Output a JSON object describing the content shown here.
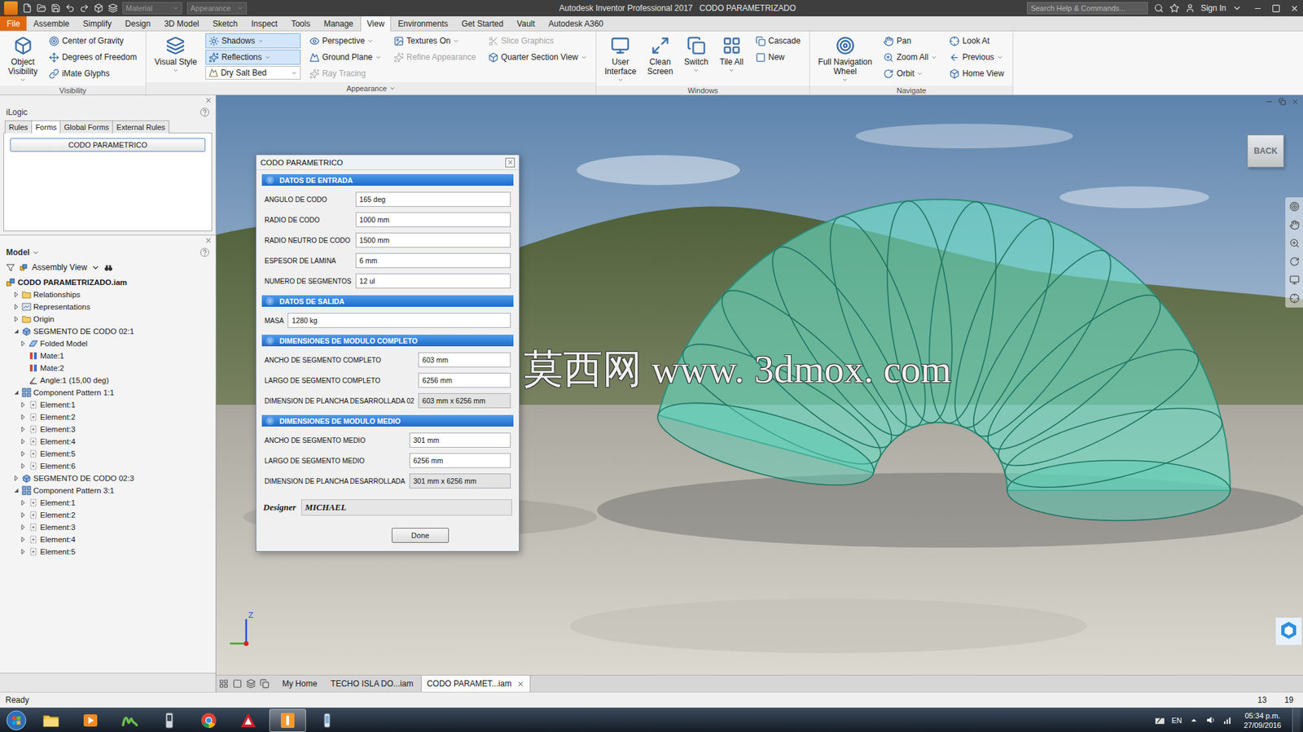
{
  "titlebar": {
    "title": "Autodesk Inventor Professional 2017",
    "document": "CODO PARAMETRIZADO",
    "combos": [
      {
        "label": "Material",
        "disabled": true
      },
      {
        "label": "Appearance",
        "disabled": true
      }
    ],
    "search": {
      "placeholder": "Search Help & Commands..."
    },
    "sign_in": "Sign In"
  },
  "menu_tabs": [
    {
      "label": "File",
      "selected": false,
      "kind": "file"
    },
    {
      "label": "Assemble",
      "selected": false,
      "kind": "tab"
    },
    {
      "label": "Simplify",
      "selected": false,
      "kind": "tab"
    },
    {
      "label": "Design",
      "selected": false,
      "kind": "tab"
    },
    {
      "label": "3D Model",
      "selected": false,
      "kind": "tab"
    },
    {
      "label": "Sketch",
      "selected": false,
      "kind": "tab"
    },
    {
      "label": "Inspect",
      "selected": false,
      "kind": "tab"
    },
    {
      "label": "Tools",
      "selected": false,
      "kind": "tab"
    },
    {
      "label": "Manage",
      "selected": false,
      "kind": "tab"
    },
    {
      "label": "View",
      "selected": true,
      "kind": "tab"
    },
    {
      "label": "Environments",
      "selected": false,
      "kind": "tab"
    },
    {
      "label": "Get Started",
      "selected": false,
      "kind": "tab"
    },
    {
      "label": "Vault",
      "selected": false,
      "kind": "tab"
    },
    {
      "label": "Autodesk A360",
      "selected": false,
      "kind": "tab"
    }
  ],
  "ribbon": {
    "panels": [
      {
        "title": "Visibility",
        "dropdown": false,
        "groups": [
          {
            "kind": "large",
            "items": [
              {
                "lines": [
                  "Object",
                  "Visibility"
                ],
                "dropdown": true,
                "selected": false,
                "disabled": false
              }
            ]
          },
          {
            "kind": "column",
            "items": [
              {
                "label": "Center of Gravity",
                "kind": "button",
                "dropdown": false,
                "selected": false,
                "disabled": false
              },
              {
                "label": "Degrees of Freedom",
                "kind": "button",
                "dropdown": false,
                "selected": false,
                "disabled": false
              },
              {
                "label": "iMate Glyphs",
                "kind": "button",
                "dropdown": false,
                "selected": false,
                "disabled": false
              }
            ]
          }
        ]
      },
      {
        "title": "Appearance",
        "dropdown": true,
        "groups": [
          {
            "kind": "large",
            "items": [
              {
                "lines": [
                  "Visual Style"
                ],
                "dropdown": true,
                "selected": false,
                "disabled": false
              }
            ]
          },
          {
            "kind": "column",
            "items": [
              {
                "label": "Shadows",
                "kind": "button",
                "dropdown": true,
                "selected": true,
                "disabled": false
              },
              {
                "label": "Reflections",
                "kind": "button",
                "dropdown": true,
                "selected": true,
                "disabled": false
              },
              {
                "label": "Dry Salt Bed",
                "kind": "combo",
                "dropdown": true,
                "selected": false,
                "disabled": false
              }
            ]
          },
          {
            "kind": "column",
            "items": [
              {
                "label": "Perspective",
                "kind": "button",
                "dropdown": true,
                "selected": false,
                "disabled": false
              },
              {
                "label": "Ground Plane",
                "kind": "button",
                "dropdown": true,
                "selected": false,
                "disabled": false
              },
              {
                "label": "Ray Tracing",
                "kind": "button",
                "dropdown": false,
                "selected": false,
                "disabled": true
              }
            ]
          },
          {
            "kind": "column",
            "items": [
              {
                "label": "Textures On",
                "kind": "button",
                "dropdown": true,
                "selected": false,
                "disabled": false
              },
              {
                "label": "Refine Appearance",
                "kind": "button",
                "dropdown": false,
                "selected": false,
                "disabled": true
              }
            ]
          },
          {
            "kind": "column",
            "items": [
              {
                "label": "Slice Graphics",
                "kind": "button",
                "dropdown": false,
                "selected": false,
                "disabled": true
              },
              {
                "label": "Quarter Section View",
                "kind": "button",
                "dropdown": true,
                "selected": false,
                "disabled": false
              }
            ]
          }
        ]
      },
      {
        "title": "Windows",
        "dropdown": false,
        "groups": [
          {
            "kind": "large",
            "items": [
              {
                "lines": [
                  "User",
                  "Interface"
                ],
                "dropdown": true,
                "selected": false,
                "disabled": false
              },
              {
                "lines": [
                  "Clean",
                  "Screen"
                ],
                "dropdown": false,
                "selected": false,
                "disabled": false
              },
              {
                "lines": [
                  "Switch"
                ],
                "dropdown": true,
                "selected": false,
                "disabled": false
              },
              {
                "lines": [
                  "Tile All"
                ],
                "dropdown": true,
                "selected": false,
                "disabled": false
              }
            ]
          },
          {
            "kind": "column",
            "items": [
              {
                "label": "Cascade",
                "kind": "button",
                "dropdown": false,
                "selected": false,
                "disabled": false
              },
              {
                "label": "New",
                "kind": "button",
                "dropdown": false,
                "selected": false,
                "disabled": false
              }
            ]
          }
        ]
      },
      {
        "title": "Navigate",
        "dropdown": false,
        "groups": [
          {
            "kind": "large",
            "items": [
              {
                "lines": [
                  "Full Navigation",
                  "Wheel"
                ],
                "dropdown": true,
                "selected": false,
                "disabled": false
              }
            ]
          },
          {
            "kind": "column",
            "items": [
              {
                "label": "Pan",
                "kind": "button",
                "dropdown": false,
                "selected": false,
                "disabled": false
              },
              {
                "label": "Zoom All",
                "kind": "button",
                "dropdown": true,
                "selected": false,
                "disabled": false
              },
              {
                "label": "Orbit",
                "kind": "button",
                "dropdown": true,
                "selected": false,
                "disabled": false
              }
            ]
          },
          {
            "kind": "column",
            "items": [
              {
                "label": "Look At",
                "kind": "button",
                "dropdown": false,
                "selected": false,
                "disabled": false
              },
              {
                "label": "Previous",
                "kind": "button",
                "dropdown": true,
                "selected": false,
                "disabled": false
              },
              {
                "label": "Home View",
                "kind": "button",
                "dropdown": false,
                "selected": false,
                "disabled": false
              }
            ]
          }
        ]
      }
    ]
  },
  "ilogic": {
    "title": "iLogic",
    "tabs": [
      {
        "label": "Rules",
        "selected": false
      },
      {
        "label": "Forms",
        "selected": true
      },
      {
        "label": "Global Forms",
        "selected": false
      },
      {
        "label": "External Rules",
        "selected": false
      }
    ],
    "forms": [
      "CODO PARAMETRICO"
    ]
  },
  "model": {
    "title": "Model",
    "view": "Assembly View",
    "tree": [
      {
        "label": "CODO PARAMETRIZADO.iam",
        "level": 0,
        "kind": "assembly",
        "expandable": false,
        "expanded": false
      },
      {
        "label": "Relationships",
        "level": 1,
        "kind": "folder",
        "expandable": true,
        "expanded": false
      },
      {
        "label": "Representations",
        "level": 1,
        "kind": "representations",
        "expandable": true,
        "expanded": false
      },
      {
        "label": "Origin",
        "level": 1,
        "kind": "folder",
        "expandable": true,
        "expanded": false
      },
      {
        "label": "SEGMENTO DE CODO 02:1",
        "level": 1,
        "kind": "part",
        "expandable": true,
        "expanded": true
      },
      {
        "label": "Folded Model",
        "level": 2,
        "kind": "folded",
        "expandable": true,
        "expanded": false
      },
      {
        "label": "Mate:1",
        "level": 2,
        "kind": "constraint",
        "expandable": false,
        "expanded": false
      },
      {
        "label": "Mate:2",
        "level": 2,
        "kind": "constraint",
        "expandable": false,
        "expanded": false
      },
      {
        "label": "Angle:1 (15,00 deg)",
        "level": 2,
        "kind": "angle",
        "expandable": false,
        "expanded": false
      },
      {
        "label": "Component Pattern 1:1",
        "level": 1,
        "kind": "pattern",
        "expandable": true,
        "expanded": true
      },
      {
        "label": "Element:1",
        "level": 2,
        "kind": "element",
        "expandable": true,
        "expanded": false
      },
      {
        "label": "Element:2",
        "level": 2,
        "kind": "element",
        "expandable": true,
        "expanded": false
      },
      {
        "label": "Element:3",
        "level": 2,
        "kind": "element",
        "expandable": true,
        "expanded": false
      },
      {
        "label": "Element:4",
        "level": 2,
        "kind": "element",
        "expandable": true,
        "expanded": false
      },
      {
        "label": "Element:5",
        "level": 2,
        "kind": "element",
        "expandable": true,
        "expanded": false
      },
      {
        "label": "Element:6",
        "level": 2,
        "kind": "element",
        "expandable": true,
        "expanded": false
      },
      {
        "label": "SEGMENTO DE CODO 02:3",
        "level": 1,
        "kind": "part",
        "expandable": true,
        "expanded": false
      },
      {
        "label": "Component Pattern 3:1",
        "level": 1,
        "kind": "pattern",
        "expandable": true,
        "expanded": true
      },
      {
        "label": "Element:1",
        "level": 2,
        "kind": "element",
        "expandable": true,
        "expanded": false
      },
      {
        "label": "Element:2",
        "level": 2,
        "kind": "element",
        "expandable": true,
        "expanded": false
      },
      {
        "label": "Element:3",
        "level": 2,
        "kind": "element",
        "expandable": true,
        "expanded": false
      },
      {
        "label": "Element:4",
        "level": 2,
        "kind": "element",
        "expandable": true,
        "expanded": false
      },
      {
        "label": "Element:5",
        "level": 2,
        "kind": "element",
        "expandable": true,
        "expanded": false
      }
    ]
  },
  "dialog": {
    "title": "CODO PARAMETRICO",
    "sections": [
      {
        "title": "DATOS DE ENTRADA",
        "fields": [
          {
            "label": "ANGULO DE CODO",
            "value": "165 deg",
            "readonly": false
          },
          {
            "label": "RADIO DE CODO",
            "value": "1000 mm",
            "readonly": false
          },
          {
            "label": "RADIO NEUTRO DE CODO",
            "value": "1500 mm",
            "readonly": false
          },
          {
            "label": "ESPESOR DE LAMINA",
            "value": "6 mm",
            "readonly": false
          },
          {
            "label": "NUMERO DE SEGMENTOS",
            "value": "12 ul",
            "readonly": false
          }
        ]
      },
      {
        "title": "DATOS DE SALIDA",
        "fields": [
          {
            "label": "MASA",
            "value": "1280 kg",
            "readonly": false
          }
        ]
      },
      {
        "title": "DIMENSIONES DE MODULO COMPLETO",
        "fields": [
          {
            "label": "ANCHO DE SEGMENTO  COMPLETO",
            "value": "603 mm",
            "readonly": false
          },
          {
            "label": "LARGO DE SEGMENTO COMPLETO",
            "value": "6256 mm",
            "readonly": false
          },
          {
            "label": "DIMENSION DE PLANCHA DESARROLLADA 02",
            "value": "603 mm x 6256 mm",
            "readonly": true
          }
        ]
      },
      {
        "title": "DIMENSIONES DE MODULO MEDIO",
        "fields": [
          {
            "label": "ANCHO DE SEGMENTO MEDIO",
            "value": "301 mm",
            "readonly": false
          },
          {
            "label": "LARGO DE SEGMENTO MEDIO",
            "value": "6256 mm",
            "readonly": false
          },
          {
            "label": "DIMENSION DE PLANCHA DESARROLLADA",
            "value": "301 mm x 6256 mm",
            "readonly": true
          }
        ]
      }
    ],
    "designer": {
      "label": "Designer",
      "value": "MICHAEL"
    },
    "button": "Done"
  },
  "viewport": {
    "viewcube": "BACK",
    "axis": "Z",
    "watermark": {
      "cjk": "莫西网",
      "latin": "www. 3dmox. com"
    }
  },
  "document_tabs": [
    {
      "label": "My Home",
      "selected": false,
      "closable": false
    },
    {
      "label": "TECHO ISLA DO...iam",
      "selected": false,
      "closable": false
    },
    {
      "label": "CODO PARAMET...iam",
      "selected": true,
      "closable": true
    }
  ],
  "status_bar": {
    "text": "Ready",
    "counts": [
      "13",
      "19"
    ]
  },
  "taskbar": {
    "apps": [
      {
        "kind": "explorer",
        "selected": false
      },
      {
        "kind": "media",
        "selected": false
      },
      {
        "kind": "movistar",
        "selected": false
      },
      {
        "kind": "device",
        "selected": false
      },
      {
        "kind": "chrome",
        "selected": false
      },
      {
        "kind": "acrobat",
        "selected": false
      },
      {
        "kind": "inventor",
        "selected": true
      },
      {
        "kind": "phone",
        "selected": false
      }
    ],
    "language": "EN",
    "time": "05:34 p.m.",
    "date": "27/09/2016"
  }
}
